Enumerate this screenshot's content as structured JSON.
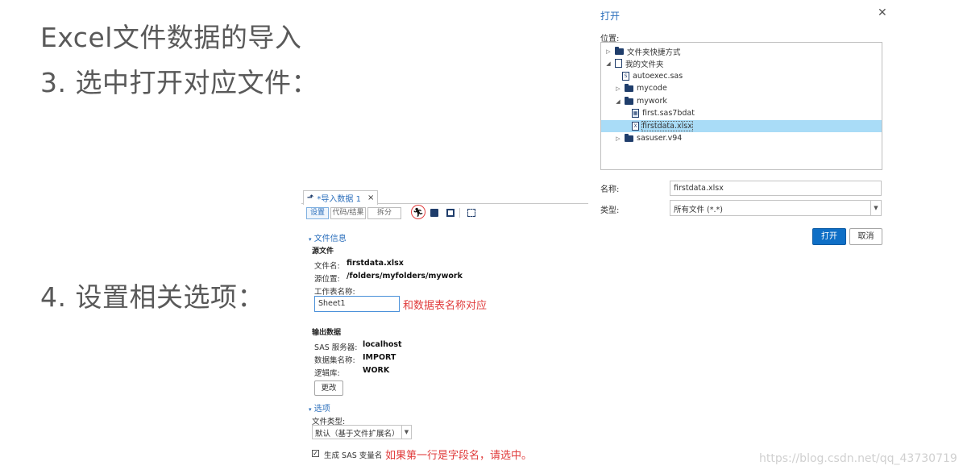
{
  "slide": {
    "line1": "Excel文件数据的导入",
    "line2": "3.  选中打开对应文件：",
    "line3": "4.  设置相关选项："
  },
  "open_dialog": {
    "title": "打开",
    "location_label": "位置:",
    "tree": [
      {
        "label": "文件夹快捷方式",
        "icon": "folder-shortcut-icon",
        "expander": "collapsed"
      },
      {
        "label": "我的文件夹",
        "icon": "my-folder-icon",
        "expander": "expanded"
      },
      {
        "label": "autoexec.sas",
        "icon": "sas-file-icon",
        "expander": "none"
      },
      {
        "label": "mycode",
        "icon": "folder-icon",
        "expander": "collapsed"
      },
      {
        "label": "mywork",
        "icon": "folder-icon",
        "expander": "expanded"
      },
      {
        "label": "first.sas7bdat",
        "icon": "table-file-icon",
        "expander": "none"
      },
      {
        "label": "firstdata.xlsx",
        "icon": "excel-file-icon",
        "expander": "none",
        "selected": true
      },
      {
        "label": "sasuser.v94",
        "icon": "folder-icon",
        "expander": "collapsed"
      }
    ],
    "name_label": "名称:",
    "name_value": "firstdata.xlsx",
    "type_label": "类型:",
    "type_value": "所有文件 (*.*)",
    "open_button": "打开",
    "cancel_button": "取消"
  },
  "import_panel": {
    "tab_label": "*导入数据 1",
    "tab_close": "×",
    "segments": [
      "设置",
      "代码/结果",
      "拆分"
    ],
    "file_info_section": "文件信息",
    "source_file_heading": "源文件",
    "file_name_label": "文件名:",
    "file_name_value": "firstdata.xlsx",
    "source_location_label": "源位置:",
    "source_location_value": "/folders/myfolders/mywork",
    "sheet_name_label": "工作表名称:",
    "sheet_name_value": "Sheet1",
    "output_heading": "输出数据",
    "sas_server_label": "SAS 服务器:",
    "sas_server_value": "localhost",
    "dataset_label": "数据集名称:",
    "dataset_value": "IMPORT",
    "library_label": "逻辑库:",
    "library_value": "WORK",
    "change_button": "更改",
    "options_section": "选项",
    "file_type_label": "文件类型:",
    "file_type_value": "默认（基于文件扩展名）",
    "generate_vars_label": "生成 SAS 变量名"
  },
  "annotations": {
    "sheet_note": "和数据表名称对应",
    "checkbox_note": "如果第一行是字段名，请选中。"
  },
  "watermark": "https://blog.csdn.net/qq_43730719",
  "colors": {
    "accent": "#2a6ebb",
    "primary_button": "#0f6fc6",
    "selection": "#a9dcf7",
    "annotation": "#e03c3c"
  }
}
